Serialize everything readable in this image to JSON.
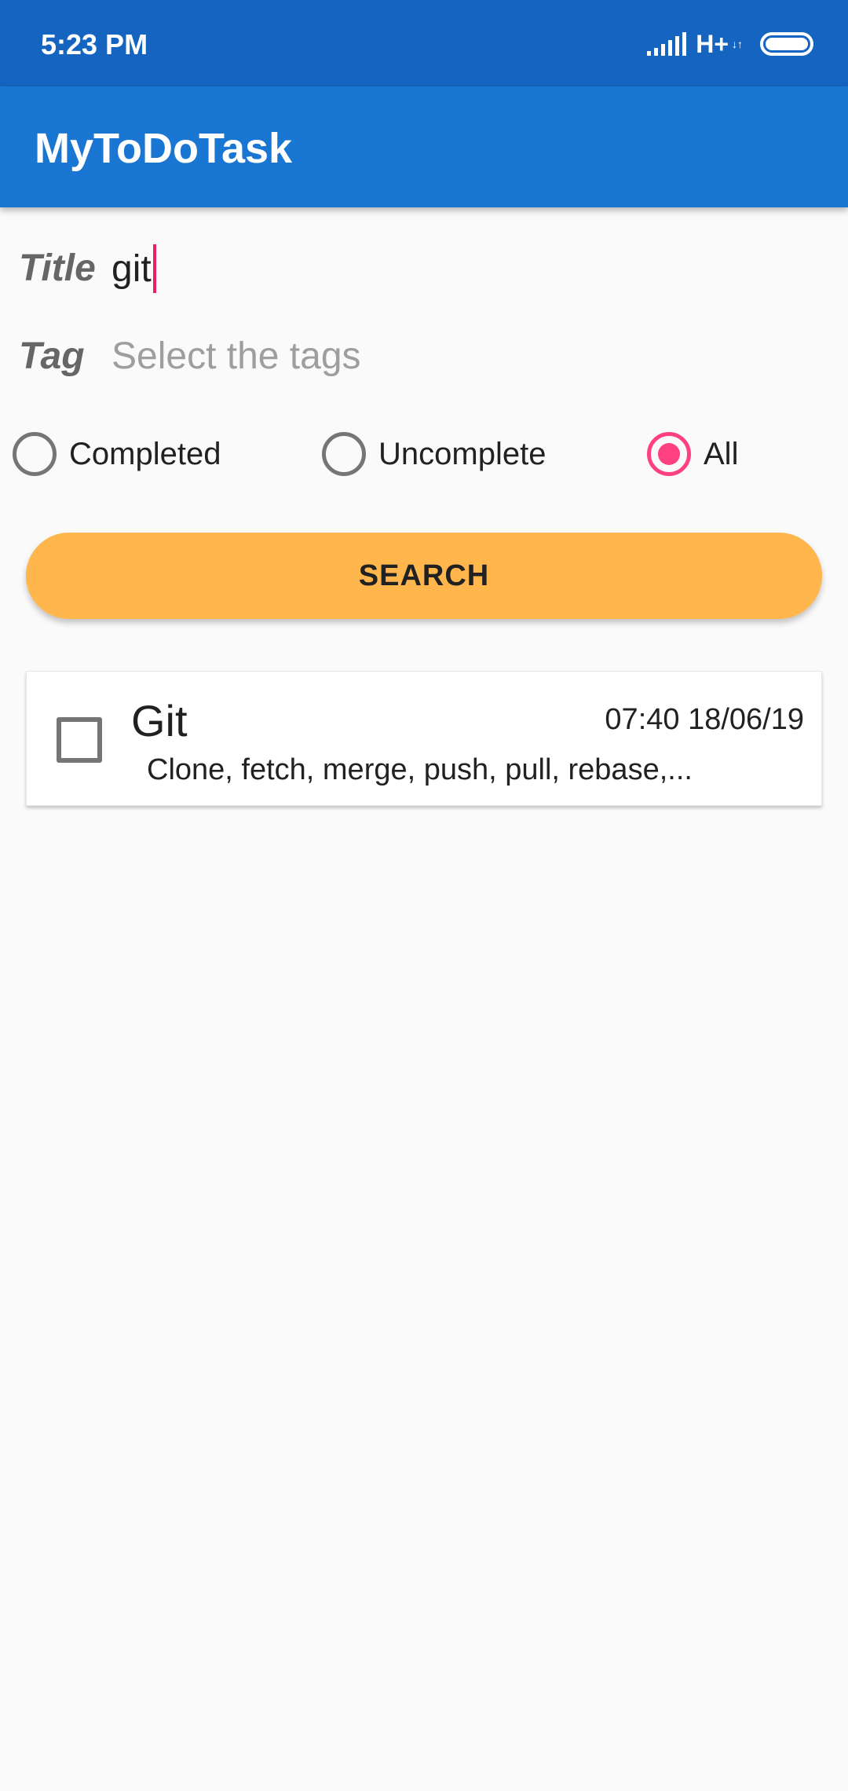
{
  "status_bar": {
    "time": "5:23 PM",
    "network": "H+",
    "network_arrows": "↓↑"
  },
  "app_bar": {
    "title": "MyToDoTask"
  },
  "filters": {
    "title_label": "Title",
    "title_value": "git",
    "tag_label": "Tag",
    "tag_placeholder": "Select the tags",
    "status_options": [
      {
        "label": "Completed",
        "checked": false
      },
      {
        "label": "Uncomplete",
        "checked": false
      },
      {
        "label": "All",
        "checked": true
      }
    ],
    "search_label": "SEARCH"
  },
  "tasks": [
    {
      "title": "Git",
      "datetime": "07:40 18/06/19",
      "description": "Clone, fetch, merge, push, pull, rebase,...",
      "completed": false
    }
  ],
  "colors": {
    "status_bar": "#1565c0",
    "app_bar": "#1976d2",
    "accent": "#ff4081",
    "button": "#ffb74d"
  }
}
